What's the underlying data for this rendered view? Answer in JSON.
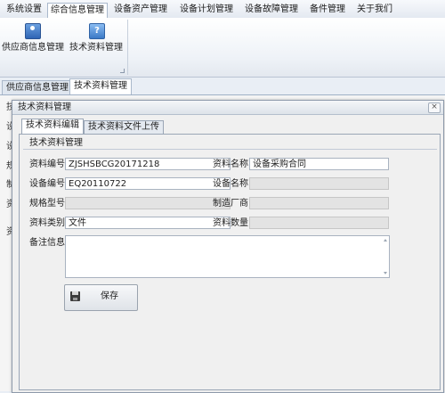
{
  "menubar": {
    "tabs": [
      {
        "label": "系统设置"
      },
      {
        "label": "综合信息管理"
      },
      {
        "label": "设备资产管理"
      },
      {
        "label": "设备计划管理"
      },
      {
        "label": "设备故障管理"
      },
      {
        "label": "备件管理"
      },
      {
        "label": "关于我们"
      }
    ],
    "active_index": 1
  },
  "ribbon": {
    "buttons": [
      {
        "label": "供应商信息管理",
        "icon": "supplier-card-icon"
      },
      {
        "label": "技术资料管理",
        "icon": "help-book-icon"
      }
    ]
  },
  "doc_tabs": [
    {
      "label": "供应商信息管理"
    },
    {
      "label": "技术资料管理"
    }
  ],
  "background_fragments": [
    "技",
    "设",
    "设",
    "规",
    "制",
    "资",
    "资",
    "I"
  ],
  "dialog": {
    "title": "技术资料管理",
    "close_glyph": "×",
    "tabs": [
      {
        "label": "技术资料编辑"
      },
      {
        "label": "技术资料文件上传"
      }
    ],
    "group_title": "技术资料管理",
    "fields": {
      "doc_no": {
        "label": "资料编号",
        "value": "ZJSHSBCG20171218"
      },
      "doc_name": {
        "label": "资料名称",
        "value": "设备采购合同"
      },
      "equip_no": {
        "label": "设备编号",
        "value": "EQ20110722"
      },
      "equip_name": {
        "label": "设备名称",
        "value": ""
      },
      "spec_model": {
        "label": "规格型号",
        "value": ""
      },
      "manufacturer": {
        "label": "制造厂商",
        "value": ""
      },
      "doc_type": {
        "label": "资料类别",
        "value": "文件"
      },
      "doc_qty": {
        "label": "资料数量",
        "value": ""
      },
      "remarks": {
        "label": "备注信息",
        "value": ""
      }
    },
    "save_label": "保存"
  },
  "colors": {
    "accent": "#2f65b5",
    "dialog_bg": "#f0f0f0",
    "disabled_field": "#e3e3e3"
  }
}
